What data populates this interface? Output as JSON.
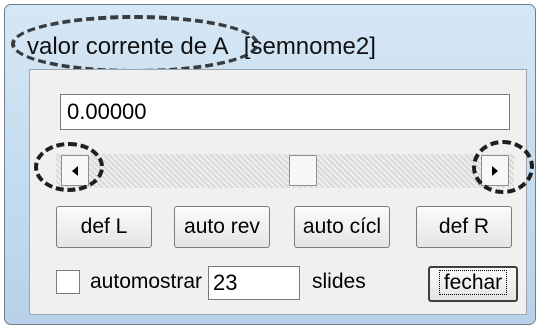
{
  "window": {
    "title_prefix": "valor corrente de A",
    "title_suffix": "[semnome2]"
  },
  "value_field": {
    "value": "0.00000"
  },
  "slider": {
    "left_icon": "arrow-left-icon",
    "right_icon": "arrow-right-icon",
    "thumb_position_fraction": 0.55
  },
  "buttons": {
    "def_l": "def L",
    "auto_rev": "auto rev",
    "auto_cicl": "auto cícl",
    "def_r": "def R"
  },
  "bottom": {
    "automostrar_label": "automostrar",
    "automostrar_checked": false,
    "slides_value": "23",
    "slides_label": "slides",
    "close_label": "fechar"
  },
  "colors": {
    "window_frame": "#c3dcef",
    "client_bg": "#f0f0f0"
  }
}
